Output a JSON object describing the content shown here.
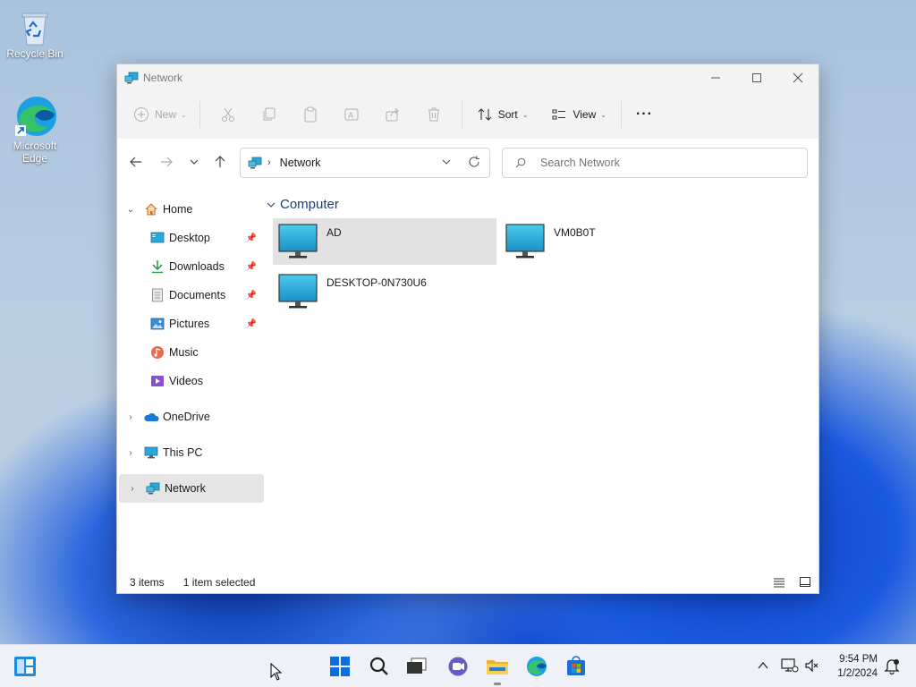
{
  "desktop": {
    "icons": [
      {
        "label": "Recycle Bin"
      },
      {
        "label": "Microsoft Edge"
      }
    ]
  },
  "window": {
    "title": "Network",
    "toolbar": {
      "new_label": "New",
      "sort_label": "Sort",
      "view_label": "View",
      "more_label": "···"
    },
    "address": {
      "current": "Network"
    },
    "search": {
      "placeholder": "Search Network"
    },
    "sidebar": {
      "items": [
        {
          "label": "Home"
        },
        {
          "label": "Desktop"
        },
        {
          "label": "Downloads"
        },
        {
          "label": "Documents"
        },
        {
          "label": "Pictures"
        },
        {
          "label": "Music"
        },
        {
          "label": "Videos"
        },
        {
          "label": "OneDrive"
        },
        {
          "label": "This PC"
        },
        {
          "label": "Network"
        }
      ]
    },
    "content": {
      "group_title": "Computer",
      "items": [
        {
          "label": "AD",
          "selected": true
        },
        {
          "label": "VM0B0T",
          "selected": false
        },
        {
          "label": "DESKTOP-0N730U6",
          "selected": false
        }
      ]
    },
    "status": {
      "count": "3 items",
      "selection": "1 item selected"
    }
  },
  "taskbar": {
    "time": "9:54 PM",
    "date": "1/2/2024"
  },
  "colors": {
    "accent": "#0067c0",
    "monitor": "#2aa8d8",
    "selected_bg": "#e2e2e2"
  }
}
